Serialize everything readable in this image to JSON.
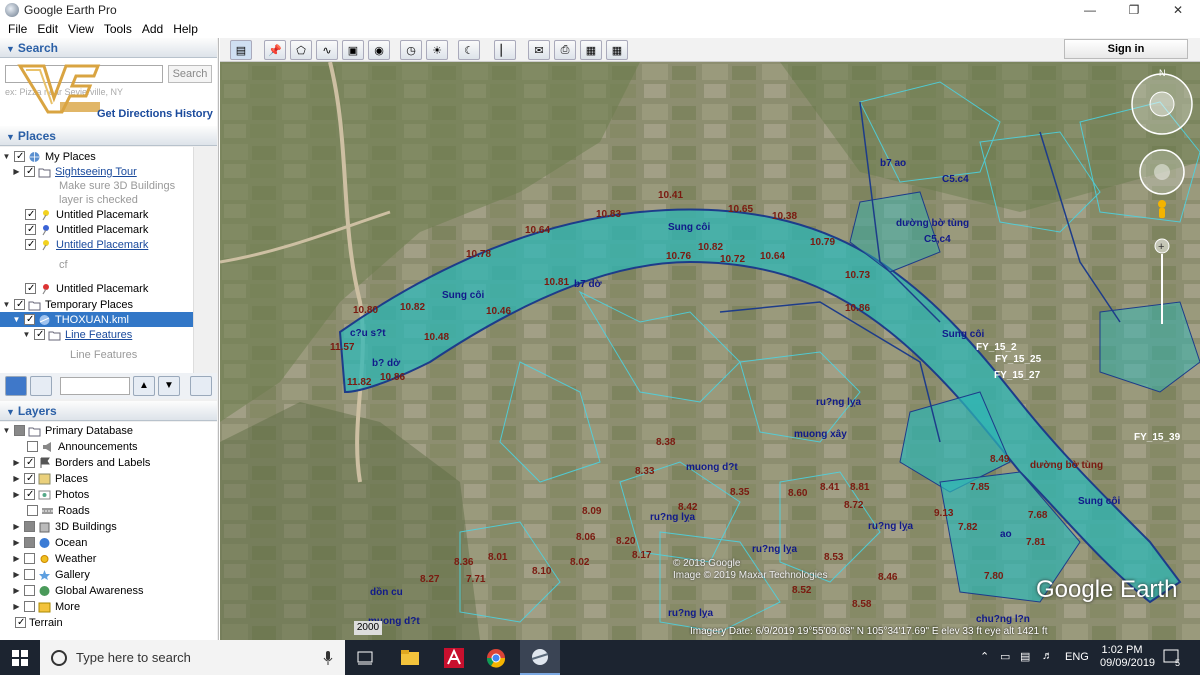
{
  "window": {
    "title": "Google Earth Pro"
  },
  "menu": [
    "File",
    "Edit",
    "View",
    "Tools",
    "Add",
    "Help"
  ],
  "search": {
    "header": "Search",
    "button": "Search",
    "hint": "ex: Pizza near Sevierville, NY",
    "get_directions": "Get Directions",
    "history": "History"
  },
  "places": {
    "header": "Places",
    "items": [
      {
        "label": "My Places"
      },
      {
        "label": "Sightseeing Tour"
      },
      {
        "label": "Make sure 3D Buildings"
      },
      {
        "label": "layer is checked"
      },
      {
        "label": "Untitled Placemark"
      },
      {
        "label": "Untitled Placemark"
      },
      {
        "label": "Untitled Placemark"
      },
      {
        "label": "cf"
      },
      {
        "label": "Untitled Placemark"
      },
      {
        "label": "Temporary Places"
      },
      {
        "label": "THOXUAN.kml"
      },
      {
        "label": "Line Features"
      },
      {
        "label": "Line Features"
      }
    ]
  },
  "layers": {
    "header": "Layers",
    "items": [
      {
        "label": "Primary Database"
      },
      {
        "label": "Announcements"
      },
      {
        "label": "Borders and Labels"
      },
      {
        "label": "Places"
      },
      {
        "label": "Photos"
      },
      {
        "label": "Roads"
      },
      {
        "label": "3D Buildings"
      },
      {
        "label": "Ocean"
      },
      {
        "label": "Weather"
      },
      {
        "label": "Gallery"
      },
      {
        "label": "Global Awareness"
      },
      {
        "label": "More"
      },
      {
        "label": "Terrain"
      }
    ]
  },
  "toolbar": {
    "signin": "Sign in"
  },
  "map": {
    "labels": [
      {
        "t": "Sung côi",
        "c": "blue"
      },
      {
        "t": "Sung côi",
        "c": "blue"
      },
      {
        "t": "Sung côi",
        "c": "blue"
      },
      {
        "t": "Sung côi",
        "c": "blue"
      },
      {
        "t": "10.41",
        "c": "red"
      },
      {
        "t": "10.83",
        "c": "red"
      },
      {
        "t": "10.65",
        "c": "red"
      },
      {
        "t": "10.38",
        "c": "red"
      },
      {
        "t": "10.64",
        "c": "red"
      },
      {
        "t": "10.78",
        "c": "red"
      },
      {
        "t": "10.82",
        "c": "red"
      },
      {
        "t": "10.76",
        "c": "red"
      },
      {
        "t": "10.72",
        "c": "red"
      },
      {
        "t": "10.64",
        "c": "red"
      },
      {
        "t": "10.79",
        "c": "red"
      },
      {
        "t": "10.73",
        "c": "red"
      },
      {
        "t": "10.81",
        "c": "red"
      },
      {
        "t": "b7 dờ",
        "c": "blue"
      },
      {
        "t": "10.86",
        "c": "red"
      },
      {
        "t": "10.80",
        "c": "red"
      },
      {
        "t": "10.82",
        "c": "red"
      },
      {
        "t": "10.46",
        "c": "red"
      },
      {
        "t": "c?u s?t",
        "c": "blue"
      },
      {
        "t": "11.57",
        "c": "red"
      },
      {
        "t": "10.48",
        "c": "red"
      },
      {
        "t": "b? dờ",
        "c": "blue"
      },
      {
        "t": "10.86",
        "c": "red"
      },
      {
        "t": "11.82",
        "c": "red"
      },
      {
        "t": "b7 ao",
        "c": "blue"
      },
      {
        "t": "C5.c4",
        "c": "blue"
      },
      {
        "t": "C5,c4",
        "c": "blue"
      },
      {
        "t": "dường bờ tùng",
        "c": "blue"
      },
      {
        "t": "FY_15_2",
        "c": "white"
      },
      {
        "t": "FY_15_25",
        "c": "white"
      },
      {
        "t": "FY_15_27",
        "c": "white"
      },
      {
        "t": "FY_15_39",
        "c": "white"
      },
      {
        "t": "dường bờ tùng",
        "c": "red"
      },
      {
        "t": "muong d?t",
        "c": "blue"
      },
      {
        "t": "ru?ng lỵa",
        "c": "blue"
      },
      {
        "t": "ru?ng lỵa",
        "c": "blue"
      },
      {
        "t": "muong xây",
        "c": "blue"
      },
      {
        "t": "ru?ng lỵa",
        "c": "blue"
      },
      {
        "t": "ru?ng lỵa",
        "c": "blue"
      },
      {
        "t": "ru?ng lỵa",
        "c": "blue"
      },
      {
        "t": "dồn cu",
        "c": "blue"
      },
      {
        "t": "muong d?t",
        "c": "blue"
      },
      {
        "t": "chu?ng l?n",
        "c": "blue"
      },
      {
        "t": "ao",
        "c": "blue"
      },
      {
        "t": "7.85",
        "c": "red"
      },
      {
        "t": "7.68",
        "c": "red"
      },
      {
        "t": "7.82",
        "c": "red"
      },
      {
        "t": "7.81",
        "c": "red"
      },
      {
        "t": "7.80",
        "c": "red"
      },
      {
        "t": "9.13",
        "c": "red"
      },
      {
        "t": "8.49",
        "c": "red"
      },
      {
        "t": "8.38",
        "c": "red"
      },
      {
        "t": "8.35",
        "c": "red"
      },
      {
        "t": "8.60",
        "c": "red"
      },
      {
        "t": "8.42",
        "c": "red"
      },
      {
        "t": "8.09",
        "c": "red"
      },
      {
        "t": "8.06",
        "c": "red"
      },
      {
        "t": "8.20",
        "c": "red"
      },
      {
        "t": "8.17",
        "c": "red"
      },
      {
        "t": "8.01",
        "c": "red"
      },
      {
        "t": "8.02",
        "c": "red"
      },
      {
        "t": "8.10",
        "c": "red"
      },
      {
        "t": "7.71",
        "c": "red"
      },
      {
        "t": "8.27",
        "c": "red"
      },
      {
        "t": "8.33",
        "c": "red"
      },
      {
        "t": "8.36",
        "c": "red"
      },
      {
        "t": "8.41",
        "c": "red"
      },
      {
        "t": "8.81",
        "c": "red"
      },
      {
        "t": "8.72",
        "c": "red"
      },
      {
        "t": "8.46",
        "c": "red"
      },
      {
        "t": "8.58",
        "c": "red"
      },
      {
        "t": "8.52",
        "c": "red"
      },
      {
        "t": "8.53",
        "c": "red"
      },
      {
        "t": "8.51",
        "c": "red"
      }
    ],
    "copyright_1": "© 2018 Google",
    "copyright_2": "Image © 2019 Maxar Technologies",
    "brand": "Google Earth",
    "year": "2000",
    "status": "Imagery Date: 6/9/2019    19°55'09.08\" N  105°34'17.69\" E  elev   33 ft    eye alt  1421 ft"
  },
  "taskbar": {
    "search_placeholder": "Type here to search",
    "lang": "ENG",
    "time": "1:02 PM",
    "date": "09/09/2019",
    "notif": "5"
  }
}
